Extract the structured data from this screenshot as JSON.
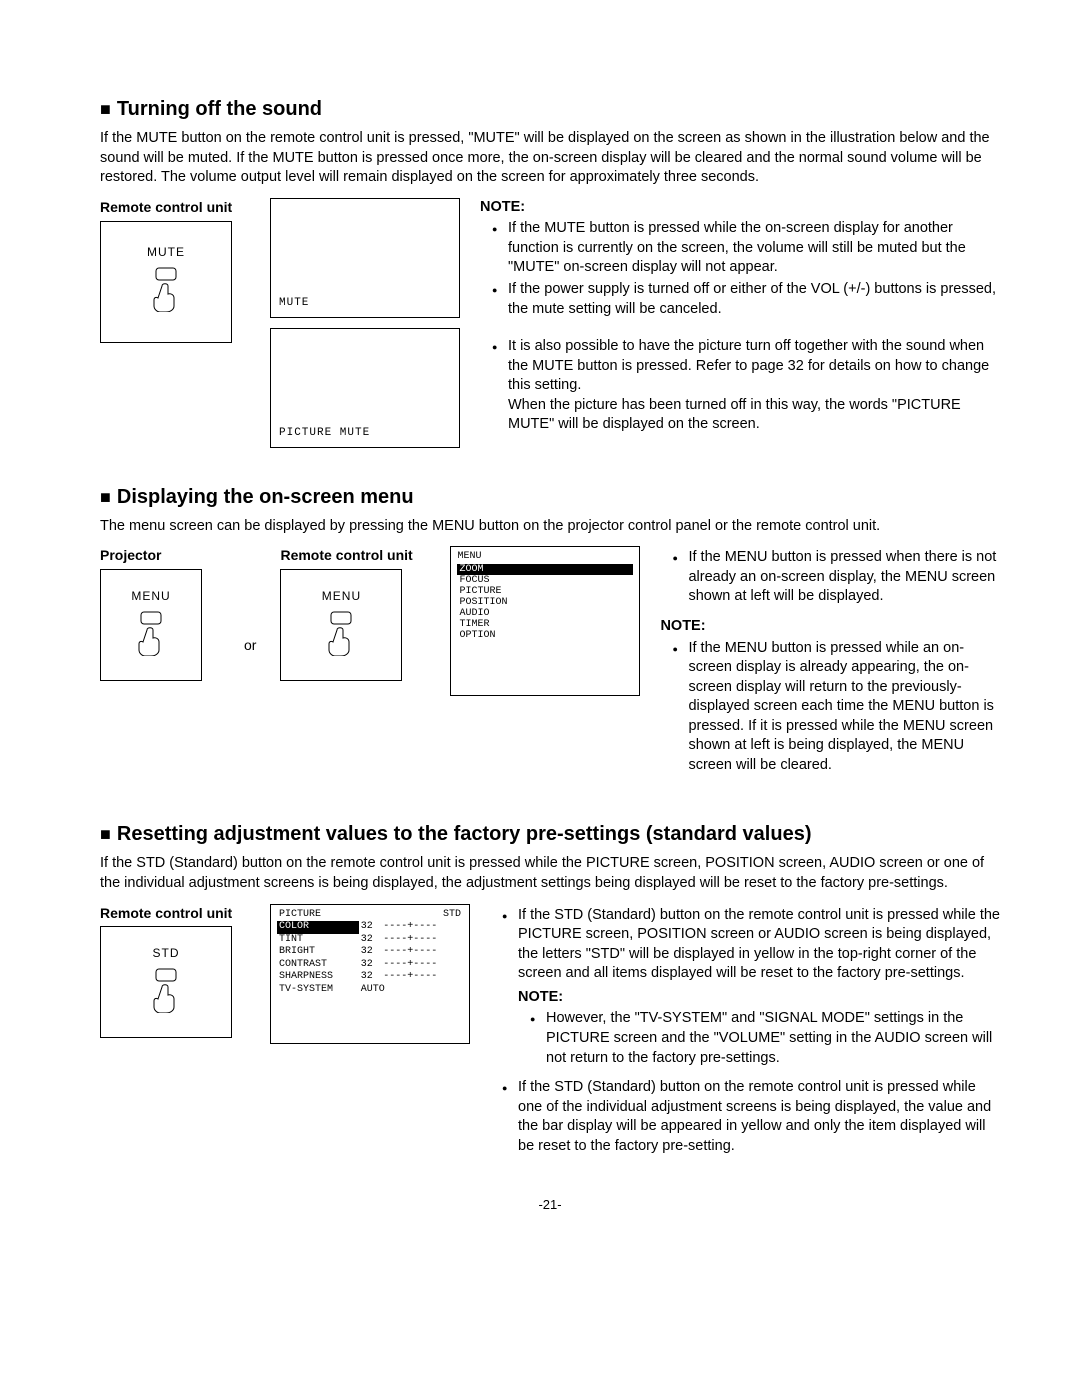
{
  "section1": {
    "heading": "Turning off the sound",
    "intro": "If the MUTE button on the remote control unit is pressed, \"MUTE\" will be displayed on the screen as shown in the illustration below and the sound will be muted. If the MUTE button is pressed once more, the on-screen display will be cleared and the normal sound volume will be restored. The volume output level will remain displayed on the screen for approximately three seconds.",
    "remote_label": "Remote control unit",
    "remote_button": "MUTE",
    "screen1_caption": "MUTE",
    "screen2_caption": "PICTURE MUTE",
    "note_title": "NOTE:",
    "note1": "If the MUTE button is pressed while the on-screen display for another function is currently on the screen, the volume will still be muted but the \"MUTE\" on-screen display will not appear.",
    "note2": "If the power supply is turned off or either of the VOL (+/-) buttons is pressed, the mute setting will be canceled.",
    "note3a": "It is also possible to have the picture turn off together with the sound when the MUTE button is pressed. Refer to page 32 for details on how to change this setting.",
    "note3b": "When the picture has been turned off in this way, the words \"PICTURE MUTE\" will be displayed on the screen."
  },
  "section2": {
    "heading": "Displaying the on-screen menu",
    "intro": "The menu screen can be displayed by pressing the MENU button on the projector control panel or the remote control unit.",
    "projector_label": "Projector",
    "remote_label": "Remote control unit",
    "or": "or",
    "button_projector": "MENU",
    "button_remote": "MENU",
    "menu_header": "MENU",
    "menu_items": [
      "ZOOM",
      "FOCUS",
      "PICTURE",
      "POSITION",
      "AUDIO",
      "TIMER",
      "OPTION"
    ],
    "right1": "If the MENU button is pressed when there is not already an on-screen display, the MENU screen shown at left will be displayed.",
    "note_title": "NOTE:",
    "right_note": "If the MENU button is pressed while an on-screen display is already appearing, the on-screen display will return to the previously-displayed screen each time the MENU button is pressed. If it is pressed while the MENU screen shown at left is being displayed, the MENU screen will be cleared."
  },
  "section3": {
    "heading": "Resetting adjustment values to the factory pre-settings (standard values)",
    "intro": "If the STD (Standard) button on the remote control unit is pressed while the PICTURE screen, POSITION screen, AUDIO screen or one of the individual adjustment screens is being displayed, the adjustment settings being displayed will be reset to the factory pre-settings.",
    "remote_label": "Remote control unit",
    "remote_button": "STD",
    "picture_header": "PICTURE",
    "picture_std": "STD",
    "picture_rows": [
      {
        "name": "COLOR",
        "val": "32",
        "bar": "----+----"
      },
      {
        "name": "TINT",
        "val": "32",
        "bar": "----+----"
      },
      {
        "name": "BRIGHT",
        "val": "32",
        "bar": "----+----"
      },
      {
        "name": "CONTRAST",
        "val": "32",
        "bar": "----+----"
      },
      {
        "name": "SHARPNESS",
        "val": "32",
        "bar": "----+----"
      },
      {
        "name": "TV-SYSTEM",
        "val": "AUTO",
        "bar": ""
      }
    ],
    "right1": "If the STD (Standard) button on the remote control unit is pressed while the PICTURE screen, POSITION screen or AUDIO screen is being displayed, the letters \"STD\" will be displayed in yellow in the top-right corner of the screen and all items displayed will be reset to the factory pre-settings.",
    "note_title": "NOTE:",
    "sub_note": "However, the \"TV-SYSTEM\" and \"SIGNAL MODE\" settings in the PICTURE screen and the \"VOLUME\" setting in the AUDIO screen will not return to the factory pre-settings.",
    "right2": "If the STD (Standard) button on the remote control unit is pressed while one of the individual adjustment screens is being displayed, the value and the bar display will be appeared in yellow and only the item displayed will be reset to the factory pre-setting."
  },
  "page_number": "-21-"
}
